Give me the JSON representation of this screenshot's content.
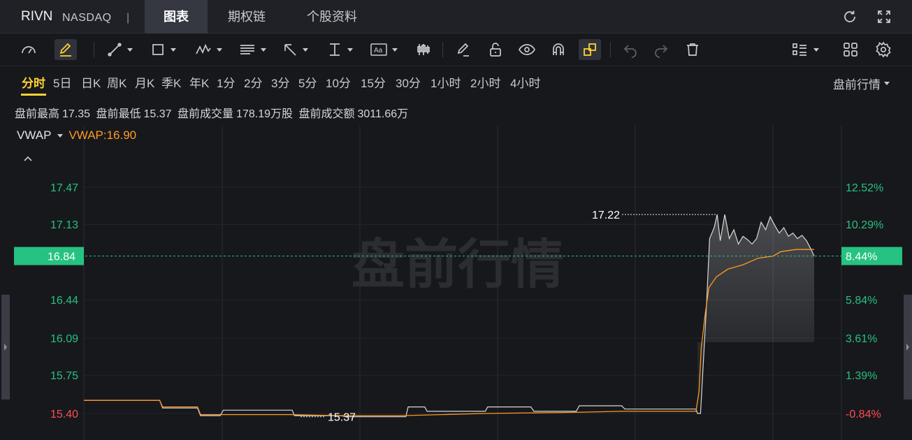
{
  "header": {
    "symbol": "RIVN",
    "exchange": "NASDAQ",
    "separator": "|",
    "tabs": [
      {
        "label": "图表",
        "active": true
      },
      {
        "label": "期权链",
        "active": false
      },
      {
        "label": "个股资料",
        "active": false
      }
    ],
    "icons": [
      "refresh-icon",
      "fullscreen-icon"
    ]
  },
  "toolbar": {
    "tools": [
      "gauge-icon",
      "draw-pen-icon",
      "trend-line-icon",
      "rectangle-icon",
      "wave-pattern-icon",
      "fib-channel-icon",
      "arrow-icon",
      "vertical-range-icon",
      "text-label-icon",
      "candlestick-icon",
      "eraser-pencil-icon",
      "unlock-icon",
      "eye-icon",
      "magnet-icon",
      "link-icon",
      "undo-icon",
      "redo-icon",
      "trash-icon",
      "list-settings-icon",
      "grid-layout-icon",
      "settings-gear-icon"
    ],
    "text_tool_label": "Aa"
  },
  "periods": {
    "items": [
      "分时",
      "5日",
      "日K",
      "周K",
      "月K",
      "季K",
      "年K",
      "1分",
      "2分",
      "3分",
      "5分",
      "10分",
      "15分",
      "30分",
      "1小时",
      "2小时",
      "4小时"
    ],
    "active": "分时",
    "session_select": "盘前行情"
  },
  "stats": {
    "high_label": "盘前最高",
    "high_value": "17.35",
    "low_label": "盘前最低",
    "low_value": "15.37",
    "volume_label": "盘前成交量",
    "volume_value": "178.19万股",
    "turnover_label": "盘前成交额",
    "turnover_value": "3011.66万"
  },
  "indicator": {
    "name": "VWAP",
    "value_text": "VWAP:16.90"
  },
  "colors": {
    "up_green": "#26c281",
    "down_red": "#ff4d4f",
    "vwap_orange": "#ff9a22",
    "accent_yellow": "#ffd233",
    "price_line": "#d9d9d9"
  },
  "chart_data": {
    "type": "line",
    "watermark": "盘前行情",
    "y_left_ticks": [
      "17.47",
      "17.13",
      "16.44",
      "16.09",
      "15.75",
      "15.40"
    ],
    "y_left_tick_values": [
      17.47,
      17.13,
      16.44,
      16.09,
      15.75,
      15.4
    ],
    "y_right_ticks": [
      "12.52%",
      "10.29%",
      "5.84%",
      "3.61%",
      "1.39%",
      "-0.84%"
    ],
    "current_price": "16.84",
    "current_change": "8.44%",
    "current_value": 16.84,
    "high_marker": "17.22",
    "high_marker_value": 17.22,
    "low_marker": "15.37",
    "low_marker_value": 15.37,
    "ylim": [
      15.2,
      17.9
    ],
    "xlim": [
      0,
      100
    ],
    "price_series": {
      "name": "",
      "x": [
        0,
        10,
        10.4,
        15,
        15.4,
        18,
        18.4,
        27.5,
        27.8,
        34,
        34.5,
        42.5,
        42.8,
        45,
        45.3,
        53,
        53.3,
        59,
        59.4,
        65,
        65.4,
        71,
        71.4,
        80.8,
        81.0,
        81.4,
        82.2,
        82.6,
        83.2,
        83.6,
        84.0,
        84.6,
        85.2,
        85.8,
        86.4,
        87.0,
        87.6,
        88.2,
        88.8,
        89.4,
        90.0,
        90.6,
        91.2,
        91.8,
        92.4,
        93.0,
        93.6,
        94.2,
        94.8,
        95.4,
        96.0,
        96.4
      ],
      "y": [
        15.52,
        15.52,
        15.45,
        15.45,
        15.38,
        15.38,
        15.43,
        15.43,
        15.38,
        15.38,
        15.37,
        15.37,
        15.46,
        15.46,
        15.42,
        15.42,
        15.46,
        15.46,
        15.42,
        15.42,
        15.47,
        15.47,
        15.44,
        15.44,
        15.4,
        15.4,
        16.4,
        17.0,
        17.1,
        17.22,
        16.98,
        17.22,
        17.0,
        17.08,
        16.95,
        17.02,
        16.99,
        16.95,
        17.0,
        17.15,
        17.08,
        17.2,
        17.12,
        17.05,
        17.1,
        17.02,
        17.05,
        17.0,
        17.03,
        16.98,
        16.9,
        16.84
      ]
    },
    "vwap_series": {
      "name": "VWAP",
      "x": [
        0,
        10,
        10.4,
        15,
        15.4,
        27,
        34,
        42,
        53,
        65,
        71,
        80.8,
        81.2,
        81.5,
        82,
        82.5,
        83.5,
        85,
        87,
        89,
        91,
        92,
        94,
        96.4
      ],
      "y": [
        15.52,
        15.52,
        15.46,
        15.46,
        15.39,
        15.39,
        15.38,
        15.38,
        15.4,
        15.41,
        15.42,
        15.42,
        15.6,
        16.0,
        16.3,
        16.55,
        16.65,
        16.72,
        16.76,
        16.82,
        16.84,
        16.88,
        16.9,
        16.9
      ]
    }
  }
}
